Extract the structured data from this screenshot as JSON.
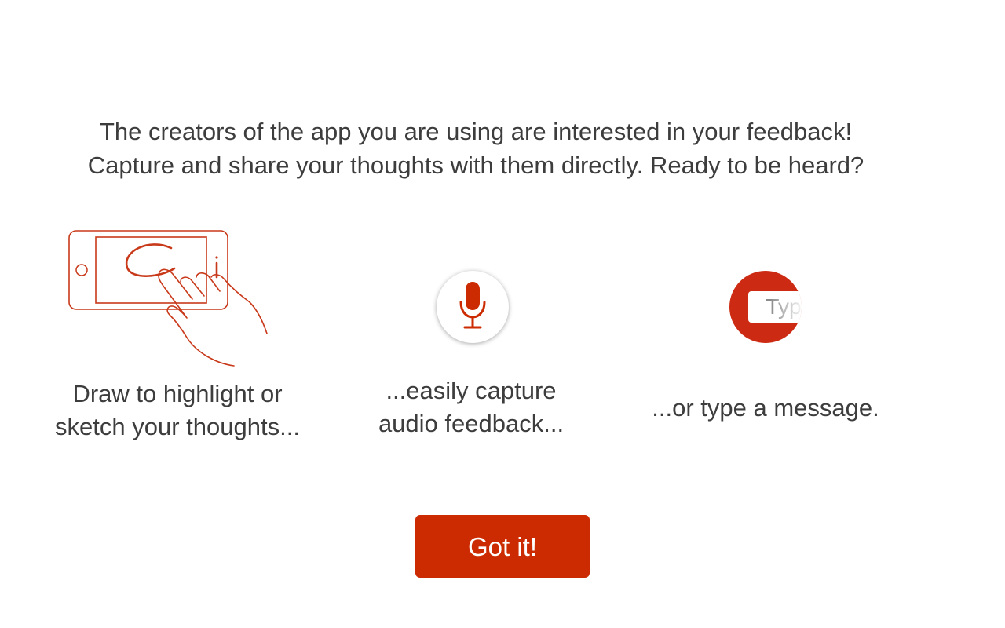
{
  "intro": {
    "line1": "The creators of the app you are using are interested in your feedback!",
    "line2": "Capture and share your thoughts with them directly. Ready to be heard?"
  },
  "features": {
    "draw": {
      "label_line1": "Draw to highlight or",
      "label_line2": "sketch your thoughts...",
      "icon": "phone-sketch-hand-illustration"
    },
    "audio": {
      "label_line1": "...easily capture",
      "label_line2": "audio feedback...",
      "icon": "microphone-icon"
    },
    "type": {
      "label": "...or type a message.",
      "field_text": "Typ",
      "icon": "text-field-icon"
    }
  },
  "button": {
    "label": "Got it!"
  },
  "colors": {
    "accent": "#cc2a00",
    "text": "#3d3d3d",
    "background": "#ffffff"
  }
}
